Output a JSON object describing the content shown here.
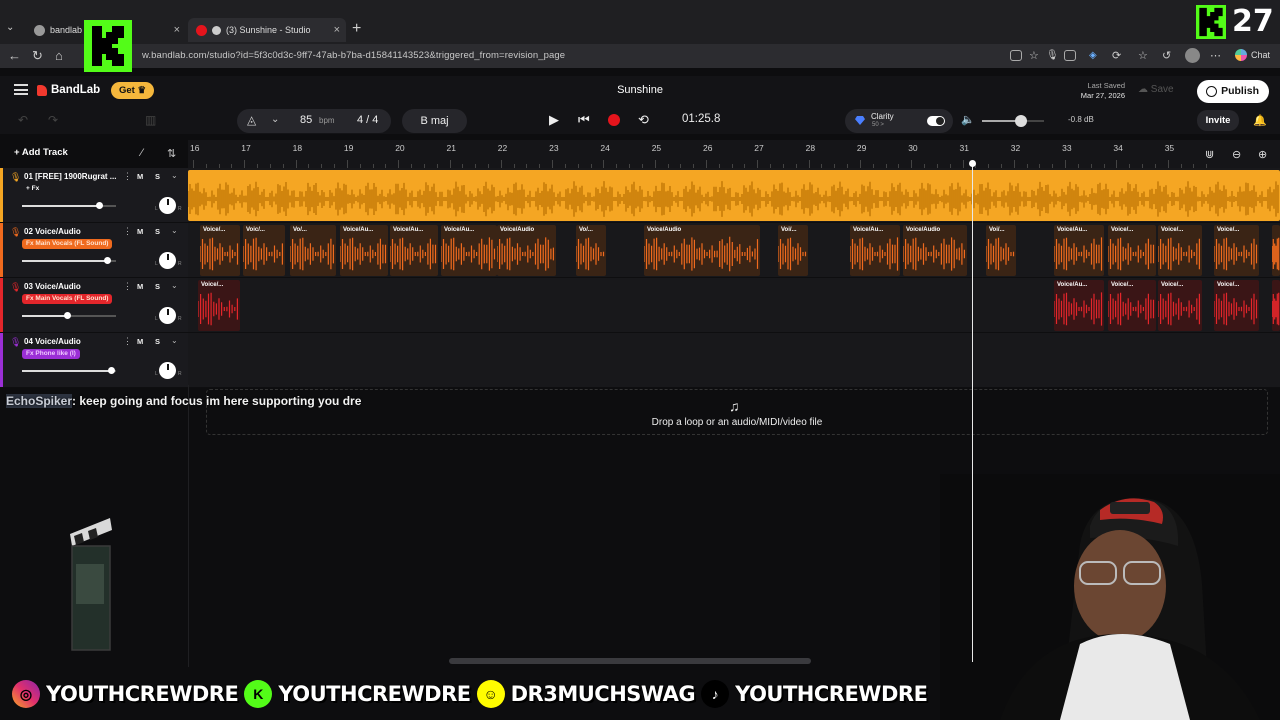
{
  "browser": {
    "tabs": [
      {
        "label": "bandlab",
        "active": false
      },
      {
        "label": "(3) Sunshine - Studio",
        "active": true
      }
    ],
    "url": "w.bandlab.com/studio?id=5f3c0d3c-9ff7-47ab-b7ba-d15841143523&triggered_from=revision_page",
    "chat_label": "Chat"
  },
  "overlay": {
    "kick_viewer_count": "27",
    "chat_user": "EchoSpiker",
    "chat_message": ": keep going and focus im here supporting you dre",
    "socials": [
      {
        "icon": "instagram-icon",
        "color": "#e1306c",
        "handle": "YOUTHCREWDRE"
      },
      {
        "icon": "kick-icon",
        "color": "#53fc18",
        "handle": "YOUTHCREWDRE"
      },
      {
        "icon": "snapchat-icon",
        "color": "#fffc00",
        "handle": "DR3MUCHSWAG"
      },
      {
        "icon": "tiktok-icon",
        "color": "#000000",
        "handle": "YOUTHCREWDRE"
      }
    ]
  },
  "header": {
    "brand": "BandLab",
    "get_label": "Get",
    "song_title": "Sunshine",
    "last_saved_label": "Last Saved",
    "last_saved_date": "Mar 27, 2026",
    "save_label": "Save",
    "publish_label": "Publish"
  },
  "transport": {
    "bpm": "85",
    "bpm_unit": "bpm",
    "time_signature": "4 / 4",
    "key": "B maj",
    "time": "01:25.8",
    "clarity_label": "Clarity",
    "clarity_sub": "50 >",
    "volume_fraction": 0.63,
    "volume_db": "-0.8 dB",
    "invite_label": "Invite"
  },
  "ruler": {
    "bars": [
      "16",
      "17",
      "18",
      "19",
      "20",
      "21",
      "22",
      "23",
      "24",
      "25",
      "26",
      "27",
      "28",
      "29",
      "30",
      "31",
      "32",
      "33",
      "34",
      "35"
    ]
  },
  "sidebar": {
    "add_track_label": "Add Track"
  },
  "tracks": [
    {
      "name": "01  [FREE] 1900Rugrat ...",
      "fx": "+ Fx",
      "color": "#f5a623",
      "volume": 0.82,
      "mute": "M",
      "solo": "S"
    },
    {
      "name": "02  Voice/Audio",
      "fx": "Fx Main Vocals (FL Sound)",
      "color": "#ef6a1e",
      "volume": 0.9,
      "mute": "M",
      "solo": "S"
    },
    {
      "name": "03  Voice/Audio",
      "fx": "Fx Main Vocals (FL Sound)",
      "color": "#e3262b",
      "volume": 0.48,
      "mute": "M",
      "solo": "S"
    },
    {
      "name": "04  Voice/Audio",
      "fx": "Fx Phone like (I)",
      "color": "#9b2fd6",
      "volume": 0.95,
      "mute": "M",
      "solo": "S"
    }
  ],
  "clips": {
    "track1_label": "",
    "track2": [
      "Voice/...",
      "Voic/...",
      "Vo/...",
      "Voice/Au...",
      "Voice/Au...",
      "Voice/Au...",
      "Voice/Audio",
      "Vo/...",
      "Voice/Audio",
      "Voi/...",
      "Voice/Au...",
      "Voice/Audio",
      "Voi/...",
      "Voice/Au...",
      "Voice/...",
      "Voice/...",
      "Voice/..."
    ],
    "track3": [
      "Voice/...",
      "Voice/Au...",
      "Voice/...",
      "Voice/...",
      "Voice/..."
    ]
  },
  "drop_zone_text": "Drop a loop or an audio/MIDI/video file",
  "colors": {
    "accent": "#f2392e",
    "get_button": "#f5b73c",
    "record": "#e5141c",
    "kick_green": "#53fc18"
  }
}
